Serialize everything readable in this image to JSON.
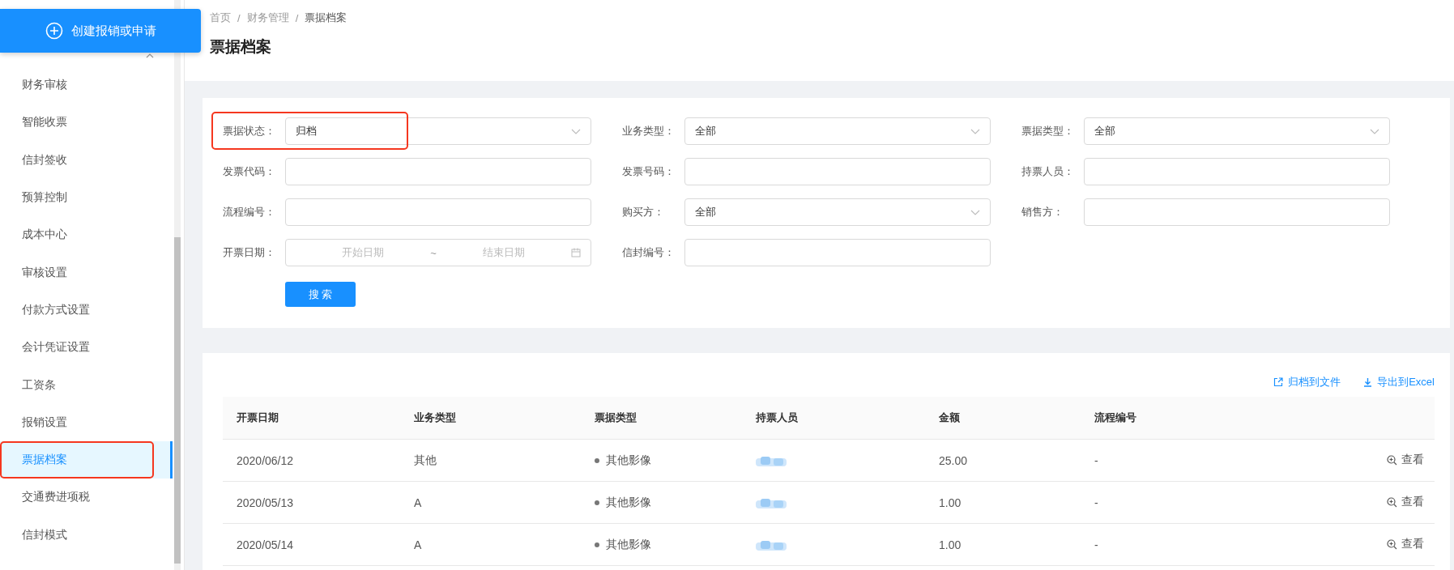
{
  "create_button": {
    "label": "创建报销或申请"
  },
  "sidebar": {
    "group": {
      "expanded": true
    },
    "items": [
      {
        "label": "财务审核",
        "selected": false,
        "annotated": false
      },
      {
        "label": "智能收票",
        "selected": false,
        "annotated": false
      },
      {
        "label": "信封签收",
        "selected": false,
        "annotated": false
      },
      {
        "label": "预算控制",
        "selected": false,
        "annotated": false
      },
      {
        "label": "成本中心",
        "selected": false,
        "annotated": false
      },
      {
        "label": "审核设置",
        "selected": false,
        "annotated": false
      },
      {
        "label": "付款方式设置",
        "selected": false,
        "annotated": false
      },
      {
        "label": "会计凭证设置",
        "selected": false,
        "annotated": false
      },
      {
        "label": "工资条",
        "selected": false,
        "annotated": false
      },
      {
        "label": "报销设置",
        "selected": false,
        "annotated": false
      },
      {
        "label": "票据档案",
        "selected": true,
        "annotated": true
      },
      {
        "label": "交通费进项税",
        "selected": false,
        "annotated": false
      },
      {
        "label": "信封模式",
        "selected": false,
        "annotated": false
      }
    ]
  },
  "breadcrumb": [
    {
      "kind": "link",
      "text": "首页"
    },
    {
      "kind": "separator",
      "text": "/"
    },
    {
      "kind": "link",
      "text": "财务管理"
    },
    {
      "kind": "separator",
      "text": "/"
    },
    {
      "kind": "current",
      "text": "票据档案"
    }
  ],
  "page_title": "票据档案",
  "filters": [
    {
      "kind": "select",
      "label": "票据状态：",
      "value": "归档",
      "annotated": true
    },
    {
      "kind": "select",
      "label": "业务类型：",
      "value": "全部",
      "annotated": false
    },
    {
      "kind": "select",
      "label": "票据类型：",
      "value": "全部",
      "annotated": false
    },
    {
      "kind": "input",
      "label": "发票代码：",
      "annotated": false
    },
    {
      "kind": "input",
      "label": "发票号码：",
      "annotated": false
    },
    {
      "kind": "input",
      "label": "持票人员：",
      "annotated": false
    },
    {
      "kind": "input",
      "label": "流程编号：",
      "annotated": false
    },
    {
      "kind": "select",
      "label": "购买方：",
      "value": "全部",
      "annotated": false
    },
    {
      "kind": "input",
      "label": "销售方：",
      "annotated": false
    },
    {
      "kind": "daterange",
      "label": "开票日期：",
      "start_placeholder": "开始日期",
      "separator": "~",
      "end_placeholder": "结束日期",
      "annotated": false
    },
    {
      "kind": "input",
      "label": "信封编号：",
      "annotated": false
    }
  ],
  "search_button": "搜 索",
  "table": {
    "actions": [
      {
        "kind": "archive",
        "label": "归档到文件"
      },
      {
        "kind": "export",
        "label": "导出到Excel"
      }
    ],
    "columns": [
      "开票日期",
      "业务类型",
      "票据类型",
      "持票人员",
      "金额",
      "流程编号"
    ],
    "rows": [
      {
        "date": "2020/06/12",
        "business_type": "其他",
        "ticket_type": "其他影像",
        "holder_redacted": true,
        "amount": "25.00",
        "process_no": "-",
        "action": "查看"
      },
      {
        "date": "2020/05/13",
        "business_type": "A",
        "ticket_type": "其他影像",
        "holder_redacted": true,
        "amount": "1.00",
        "process_no": "-",
        "action": "查看"
      },
      {
        "date": "2020/05/14",
        "business_type": "A",
        "ticket_type": "其他影像",
        "holder_redacted": true,
        "amount": "1.00",
        "process_no": "-",
        "action": "查看"
      }
    ]
  }
}
